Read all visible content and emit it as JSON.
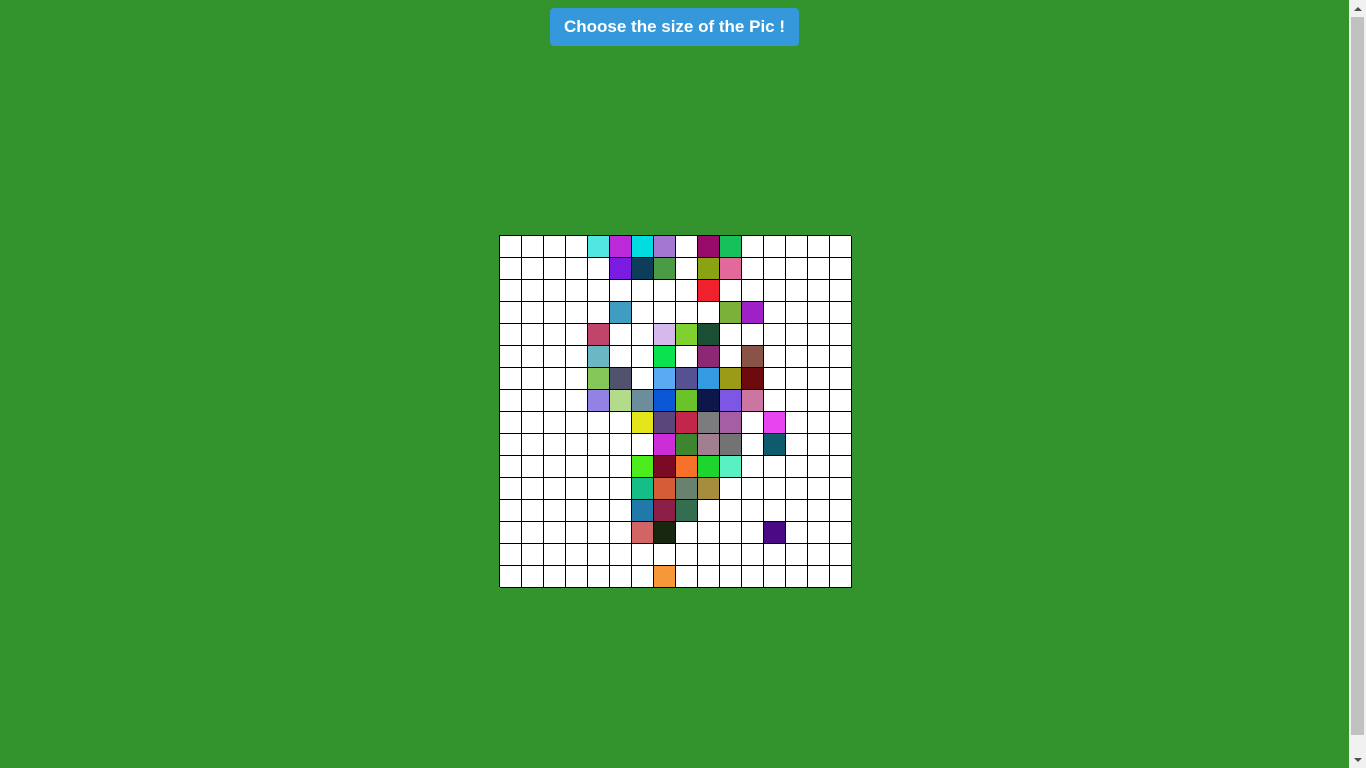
{
  "header": {
    "button_label": "Choose the size of the Pic !"
  },
  "grid": {
    "rows": 16,
    "cols": 16,
    "colored_cells": [
      {
        "r": 0,
        "c": 4,
        "color": "#51e6e0"
      },
      {
        "r": 0,
        "c": 5,
        "color": "#bc29d8"
      },
      {
        "r": 0,
        "c": 6,
        "color": "#00dde0"
      },
      {
        "r": 0,
        "c": 7,
        "color": "#a377d2"
      },
      {
        "r": 0,
        "c": 9,
        "color": "#990b6b"
      },
      {
        "r": 0,
        "c": 10,
        "color": "#16c05a"
      },
      {
        "r": 1,
        "c": 5,
        "color": "#7b1ae0"
      },
      {
        "r": 1,
        "c": 6,
        "color": "#0e3d59"
      },
      {
        "r": 1,
        "c": 7,
        "color": "#4b9b46"
      },
      {
        "r": 1,
        "c": 9,
        "color": "#8aa313"
      },
      {
        "r": 1,
        "c": 10,
        "color": "#e3699b"
      },
      {
        "r": 2,
        "c": 9,
        "color": "#f0202c"
      },
      {
        "r": 3,
        "c": 5,
        "color": "#3e9dc1"
      },
      {
        "r": 3,
        "c": 10,
        "color": "#7bb139"
      },
      {
        "r": 3,
        "c": 11,
        "color": "#a020c8"
      },
      {
        "r": 4,
        "c": 4,
        "color": "#c0456b"
      },
      {
        "r": 4,
        "c": 7,
        "color": "#d6b9ec"
      },
      {
        "r": 4,
        "c": 8,
        "color": "#7ed12e"
      },
      {
        "r": 4,
        "c": 9,
        "color": "#1a4f33"
      },
      {
        "r": 5,
        "c": 4,
        "color": "#6bb7c3"
      },
      {
        "r": 5,
        "c": 7,
        "color": "#0ae34d"
      },
      {
        "r": 5,
        "c": 9,
        "color": "#8c2874"
      },
      {
        "r": 5,
        "c": 11,
        "color": "#8a5348"
      },
      {
        "r": 6,
        "c": 4,
        "color": "#86c75a"
      },
      {
        "r": 6,
        "c": 5,
        "color": "#50536b"
      },
      {
        "r": 6,
        "c": 7,
        "color": "#5aaaf3"
      },
      {
        "r": 6,
        "c": 8,
        "color": "#565193"
      },
      {
        "r": 6,
        "c": 9,
        "color": "#339be0"
      },
      {
        "r": 6,
        "c": 10,
        "color": "#9b9b18"
      },
      {
        "r": 6,
        "c": 11,
        "color": "#6c0a0d"
      },
      {
        "r": 7,
        "c": 4,
        "color": "#9381e4"
      },
      {
        "r": 7,
        "c": 5,
        "color": "#b2dc8a"
      },
      {
        "r": 7,
        "c": 6,
        "color": "#6c8d9b"
      },
      {
        "r": 7,
        "c": 7,
        "color": "#0b58d7"
      },
      {
        "r": 7,
        "c": 8,
        "color": "#6ac329"
      },
      {
        "r": 7,
        "c": 9,
        "color": "#0e174a"
      },
      {
        "r": 7,
        "c": 10,
        "color": "#7d57e4"
      },
      {
        "r": 7,
        "c": 11,
        "color": "#cd75a1"
      },
      {
        "r": 8,
        "c": 6,
        "color": "#e5e51b"
      },
      {
        "r": 8,
        "c": 7,
        "color": "#5a4678"
      },
      {
        "r": 8,
        "c": 8,
        "color": "#c2264a"
      },
      {
        "r": 8,
        "c": 9,
        "color": "#7c7b7d"
      },
      {
        "r": 8,
        "c": 10,
        "color": "#a65ea2"
      },
      {
        "r": 8,
        "c": 12,
        "color": "#e645ef"
      },
      {
        "r": 9,
        "c": 7,
        "color": "#cc2dd6"
      },
      {
        "r": 9,
        "c": 8,
        "color": "#3d852e"
      },
      {
        "r": 9,
        "c": 9,
        "color": "#a08090"
      },
      {
        "r": 9,
        "c": 10,
        "color": "#737373"
      },
      {
        "r": 9,
        "c": 12,
        "color": "#0d5b6d"
      },
      {
        "r": 10,
        "c": 6,
        "color": "#4dec1d"
      },
      {
        "r": 10,
        "c": 7,
        "color": "#7b0a24"
      },
      {
        "r": 10,
        "c": 8,
        "color": "#f8712a"
      },
      {
        "r": 10,
        "c": 9,
        "color": "#1ed52f"
      },
      {
        "r": 10,
        "c": 10,
        "color": "#58f1c4"
      },
      {
        "r": 11,
        "c": 6,
        "color": "#14bf87"
      },
      {
        "r": 11,
        "c": 7,
        "color": "#d55c37"
      },
      {
        "r": 11,
        "c": 8,
        "color": "#69816f"
      },
      {
        "r": 11,
        "c": 9,
        "color": "#a68c3d"
      },
      {
        "r": 12,
        "c": 6,
        "color": "#2179aa"
      },
      {
        "r": 12,
        "c": 7,
        "color": "#8c1f48"
      },
      {
        "r": 12,
        "c": 8,
        "color": "#346e50"
      },
      {
        "r": 13,
        "c": 6,
        "color": "#d26464"
      },
      {
        "r": 13,
        "c": 7,
        "color": "#172710"
      },
      {
        "r": 13,
        "c": 12,
        "color": "#4a0a86"
      },
      {
        "r": 15,
        "c": 7,
        "color": "#f79838"
      }
    ]
  },
  "colors": {
    "background": "#33932c",
    "button": "#3498db",
    "cell_empty": "#ffffff",
    "gridline": "#000000"
  }
}
